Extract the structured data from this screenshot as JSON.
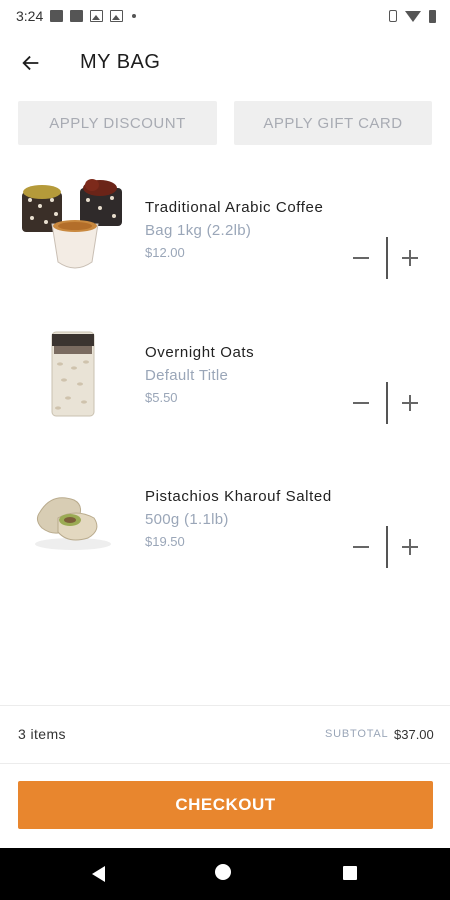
{
  "status_bar": {
    "time": "3:24"
  },
  "header": {
    "title": "MY BAG"
  },
  "actions": {
    "apply_discount": "APPLY DISCOUNT",
    "apply_gift_card": "APPLY GIFT CARD"
  },
  "items": [
    {
      "name": "Traditional Arabic Coffee",
      "variant": "Bag 1kg (2.2lb)",
      "price": "$12.00"
    },
    {
      "name": "Overnight Oats",
      "variant": "Default Title",
      "price": "$5.50"
    },
    {
      "name": "Pistachios Kharouf Salted",
      "variant": "500g (1.1lb)",
      "price": "$19.50"
    }
  ],
  "summary": {
    "items_count": "3 items",
    "subtotal_label": "SUBTOTAL",
    "subtotal_value": "$37.00"
  },
  "checkout": {
    "label": "CHECKOUT"
  },
  "colors": {
    "accent": "#e8862e",
    "muted_text": "#9aa6b8",
    "button_bg": "#efefef"
  }
}
